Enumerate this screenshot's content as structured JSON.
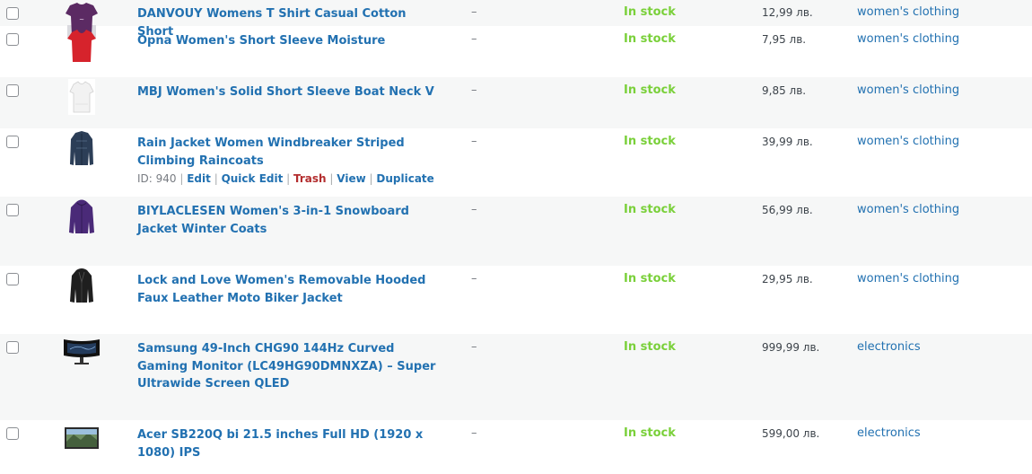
{
  "products": [
    {
      "name": "DANVOUY Womens T Shirt Casual Cotton Short",
      "sku": "–",
      "stock": "In stock",
      "price": "12,99 лв.",
      "category": "women's clothing",
      "thumb_icon": "purple-tshirt-icon"
    },
    {
      "name": "Opna Women's Short Sleeve Moisture",
      "sku": "–",
      "stock": "In stock",
      "price": "7,95 лв.",
      "category": "women's clothing",
      "thumb_icon": "red-tshirt-icon"
    },
    {
      "name": "MBJ Women's Solid Short Sleeve Boat Neck V",
      "sku": "–",
      "stock": "In stock",
      "price": "9,85 лв.",
      "category": "women's clothing",
      "thumb_icon": "white-top-icon"
    },
    {
      "name": "Rain Jacket Women Windbreaker Striped Climbing Raincoats",
      "sku": "–",
      "stock": "In stock",
      "price": "39,99 лв.",
      "category": "women's clothing",
      "thumb_icon": "navy-raincoat-icon",
      "row_actions": {
        "id_text": "ID: 940",
        "edit": "Edit",
        "quick_edit": "Quick Edit",
        "trash": "Trash",
        "view": "View",
        "duplicate": "Duplicate"
      }
    },
    {
      "name": "BIYLACLESEN Women's 3-in-1 Snowboard Jacket Winter Coats",
      "sku": "–",
      "stock": "In stock",
      "price": "56,99 лв.",
      "category": "women's clothing",
      "thumb_icon": "purple-jacket-icon"
    },
    {
      "name": "Lock and Love Women's Removable Hooded Faux Leather Moto Biker Jacket",
      "sku": "–",
      "stock": "In stock",
      "price": "29,95 лв.",
      "category": "women's clothing",
      "thumb_icon": "black-leather-jacket-icon"
    },
    {
      "name": "Samsung 49-Inch CHG90 144Hz Curved Gaming Monitor (LC49HG90DMNXZA) – Super Ultrawide Screen QLED",
      "sku": "–",
      "stock": "In stock",
      "price": "999,99 лв.",
      "category": "electronics",
      "thumb_icon": "ultrawide-monitor-icon"
    },
    {
      "name": "Acer SB220Q bi 21.5 inches Full HD (1920 x 1080) IPS",
      "sku": "–",
      "stock": "In stock",
      "price": "599,00 лв.",
      "category": "electronics",
      "thumb_icon": "monitor-icon"
    }
  ],
  "colors": {
    "link": "#2271b1",
    "in_stock": "#7ad03a",
    "trash": "#b32d2e",
    "alt_row": "#f6f7f7"
  }
}
